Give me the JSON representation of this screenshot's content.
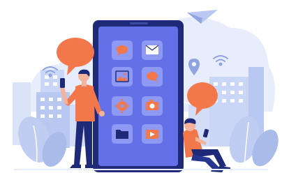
{
  "colors": {
    "background": "#ffffff",
    "cloud": "#e8edfb",
    "building": "#c9d6f5",
    "building_dark": "#a9bbe9",
    "building_window": "#ffffff",
    "phone_body": "#1e2a78",
    "phone_screen": "#6470e8",
    "app_tile": "#8e99f3",
    "app_icon": "#f2774a",
    "bubble": "#f2774a",
    "plant": "#bfcdf3",
    "person_shirt": "#f2774a",
    "person_pants": "#1e2a78",
    "person_skin": "#f4b39a",
    "person_hair": "#1e2a78",
    "wire": "#ffffff"
  },
  "icons": {
    "apps": [
      "chat-bubble-icon",
      "mail-icon",
      "image-icon",
      "chat-bubble-icon",
      "gear-icon",
      "camera-icon",
      "folder-icon",
      "video-icon"
    ],
    "decor": [
      "paper-plane-icon",
      "wifi-icon",
      "location-pin-icon",
      "wifi-icon"
    ]
  },
  "scene": {
    "figures": [
      "standing-man-with-phone",
      "sitting-man-with-phone"
    ],
    "speech_bubbles": 2
  }
}
